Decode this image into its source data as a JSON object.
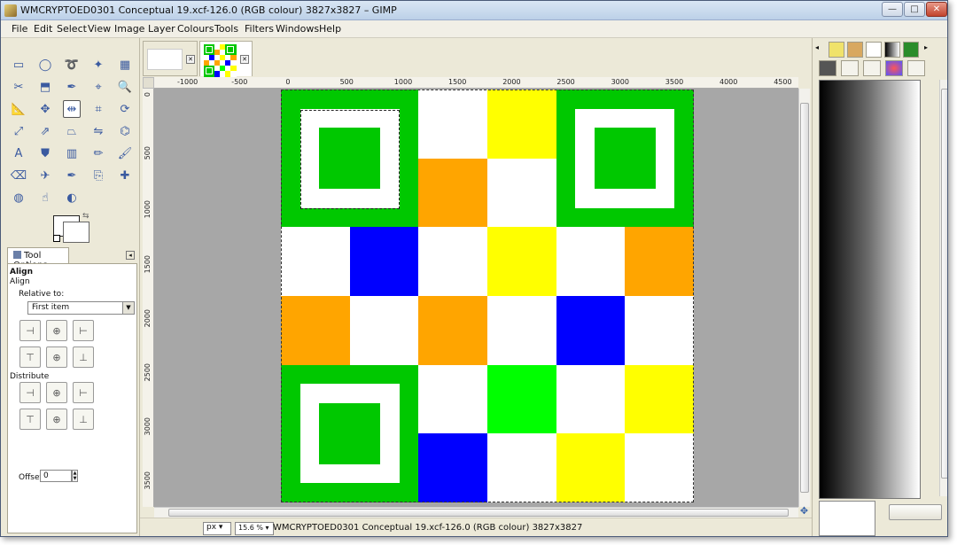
{
  "window": {
    "title": "WMCRYPTOED0301 Conceptual 19.xcf-126.0 (RGB colour) 3827x3827 – GIMP",
    "min_label": "—",
    "max_label": "□",
    "close_label": "✕"
  },
  "menu": [
    "File",
    "Edit",
    "Select",
    "View",
    "Image",
    "Layer",
    "Colours",
    "Tools",
    "Filters",
    "Windows",
    "Help"
  ],
  "toolbox": {
    "tool_icons": [
      "rect-select-icon",
      "ellipse-select-icon",
      "lasso-icon",
      "fuzzy-select-icon",
      "color-select-icon",
      "scissors-icon",
      "foreground-select-icon",
      "paths-icon",
      "color-picker-icon",
      "zoom-icon",
      "measure-icon",
      "move-icon",
      "align-icon",
      "crop-icon",
      "rotate-icon",
      "scale-icon",
      "shear-icon",
      "perspective-icon",
      "flip-icon",
      "cage-icon",
      "text-icon",
      "bucket-fill-icon",
      "blend-icon",
      "pencil-icon",
      "paintbrush-icon",
      "eraser-icon",
      "airbrush-icon",
      "ink-icon",
      "clone-icon",
      "heal-icon",
      "blur-icon",
      "smudge-icon",
      "dodge-burn-icon"
    ]
  },
  "tool_options": {
    "tab_label": "Tool Options",
    "heading": "Align",
    "subheading": "Align",
    "relative_label": "Relative to:",
    "relative_value": "First item",
    "distribute_label": "Distribute",
    "offset_label": "Offset:",
    "offset_value": "0"
  },
  "ruler_h": [
    "-1000",
    "-500",
    "0",
    "500",
    "1000",
    "1500",
    "2000",
    "2500",
    "3000",
    "3500",
    "4000",
    "4500"
  ],
  "ruler_v": [
    "0",
    "500",
    "1000",
    "1500",
    "2000",
    "2500",
    "3000",
    "3500"
  ],
  "canvas_grid": [
    [
      "#00c800",
      "#00c800",
      "#ffffff",
      "#ffff00",
      "#00c800",
      "#00c800"
    ],
    [
      "#00c800",
      "#00c800",
      "#ffa500",
      "#ffffff",
      "#00c800",
      "#00c800"
    ],
    [
      "#ffffff",
      "#0000ff",
      "#ffffff",
      "#ffff00",
      "#ffffff",
      "#ffa500"
    ],
    [
      "#ffa500",
      "#ffffff",
      "#ffa500",
      "#ffffff",
      "#0000ff",
      "#ffffff"
    ],
    [
      "#00c800",
      "#00c800",
      "#ffffff",
      "#00ff00",
      "#ffffff",
      "#ffff00"
    ],
    [
      "#00c800",
      "#00c800",
      "#0000ff",
      "#ffffff",
      "#ffff00",
      "#ffffff"
    ]
  ],
  "colors": {
    "finder_green": "#00c800",
    "inner_white": "#ffffff",
    "canvas_surround": "#a7a7a7"
  },
  "status": {
    "unit": "px",
    "zoom": "15.6 %",
    "text": "WMCRYPTOED0301 Conceptual 19.xcf-126.0 (RGB colour) 3827x3827"
  },
  "dock": {
    "tabs": [
      "palette-icon",
      "brush-icon",
      "pattern-icon",
      "gradient-icon",
      "fonts-icon"
    ],
    "sub_tabs": [
      "paint-dynamics-icon",
      "stamp-icon",
      "brush-small-icon",
      "colour-wheel-icon",
      "swatches-icon"
    ]
  }
}
